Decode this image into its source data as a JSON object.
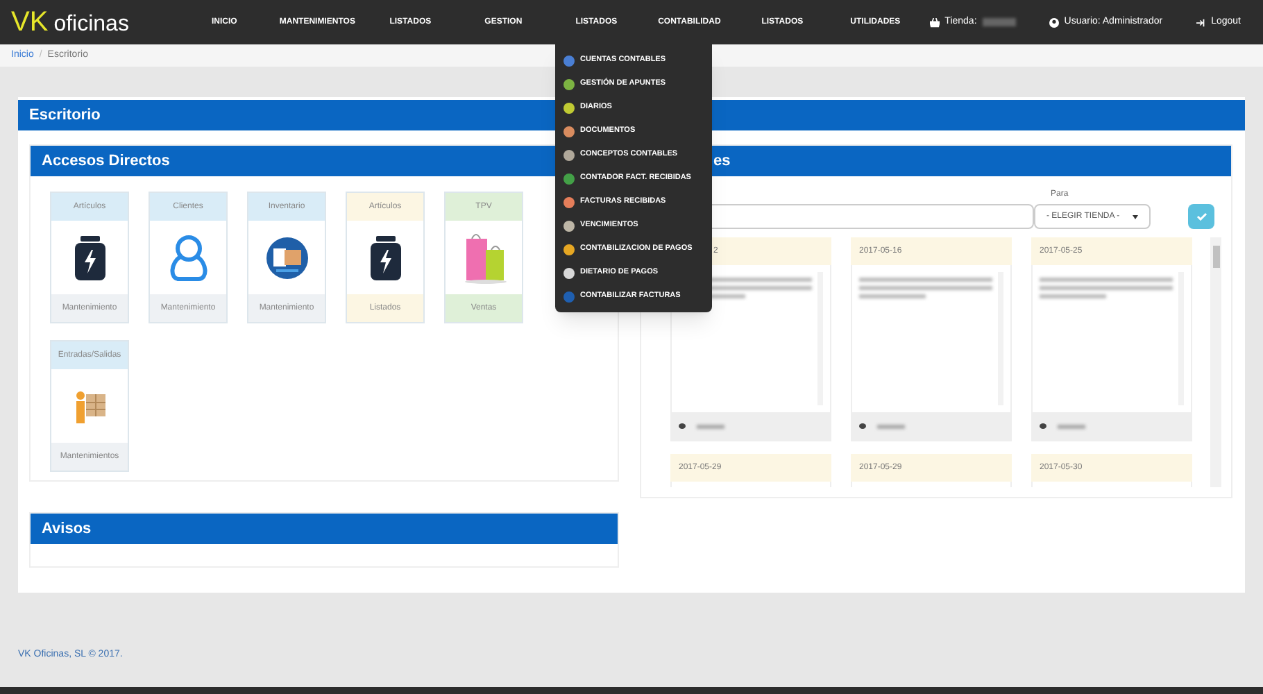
{
  "brand": {
    "first": "VK",
    "second": "oficinas"
  },
  "nav": [
    {
      "label": "INICIO"
    },
    {
      "label": "MANTENIMIENTOS"
    },
    {
      "label": "LISTADOS"
    },
    {
      "label": "GESTION"
    },
    {
      "label": "LISTADOS"
    },
    {
      "label": "CONTABILIDAD"
    },
    {
      "label": "LISTADOS"
    },
    {
      "label": "UTILIDADES"
    }
  ],
  "user_menu": {
    "store_label": "Tienda:",
    "user": "Usuario: Administrador",
    "logout": "Logout"
  },
  "breadcrumb": [
    {
      "label": "Inicio",
      "kind": "link"
    },
    {
      "label": "/",
      "kind": "separator"
    },
    {
      "label": "Escritorio",
      "kind": "current"
    }
  ],
  "dropdown": [
    {
      "label": "CUENTAS CONTABLES",
      "color": "#4a7fd4"
    },
    {
      "label": "GESTIÓN DE APUNTES",
      "color": "#7cb342"
    },
    {
      "label": "DIARIOS",
      "color": "#c0ca33"
    },
    {
      "label": "DOCUMENTOS",
      "color": "#d98c5f"
    },
    {
      "label": "CONCEPTOS CONTABLES",
      "color": "#b0a89a"
    },
    {
      "label": "CONTADOR FACT. RECIBIDAS",
      "color": "#43a047"
    },
    {
      "label": "FACTURAS RECIBIDAS",
      "color": "#e57e5a"
    },
    {
      "label": "VENCIMIENTOS",
      "color": "#bdb6a6"
    },
    {
      "label": "CONTABILIZACION DE PAGOS",
      "color": "#e6a723"
    },
    {
      "label": "DIETARIO DE PAGOS",
      "color": "#d8d8d8"
    },
    {
      "label": "CONTABILIZAR FACTURAS",
      "color": "#1f5fb0"
    }
  ],
  "main_title": "Escritorio",
  "shortcuts_title": "Accesos Directos",
  "shortcuts": [
    {
      "title": "Artículos",
      "footer": "Mantenimiento",
      "kind": "jar",
      "color": "#d9ecf7"
    },
    {
      "title": "Clientes",
      "footer": "Mantenimiento",
      "kind": "person",
      "color": "#d9ecf7"
    },
    {
      "title": "Inventario",
      "footer": "Mantenimiento",
      "kind": "inventory",
      "color": "#d9ecf7"
    },
    {
      "title": "Artículos",
      "footer": "Listados",
      "kind": "jar",
      "color": "#fcf6e3"
    },
    {
      "title": "TPV",
      "footer": "Ventas",
      "kind": "bags",
      "color": "#dff0d8"
    },
    {
      "title": "Entradas/Salidas",
      "footer": "Mantenimientos",
      "kind": "worker",
      "color": "#d9ecf7"
    }
  ],
  "notices_title": "Avisos",
  "messages": {
    "title": "es",
    "to_label": "Para",
    "store_select": "- ELEGIR TIENDA -",
    "cards": [
      {
        "date": "2"
      },
      {
        "date": "2017-05-16"
      },
      {
        "date": "2017-05-25"
      },
      {
        "date": "2017-05-29"
      },
      {
        "date": "2017-05-29"
      },
      {
        "date": "2017-05-30"
      }
    ]
  },
  "footer": "VK Oficinas, SL © 2017."
}
